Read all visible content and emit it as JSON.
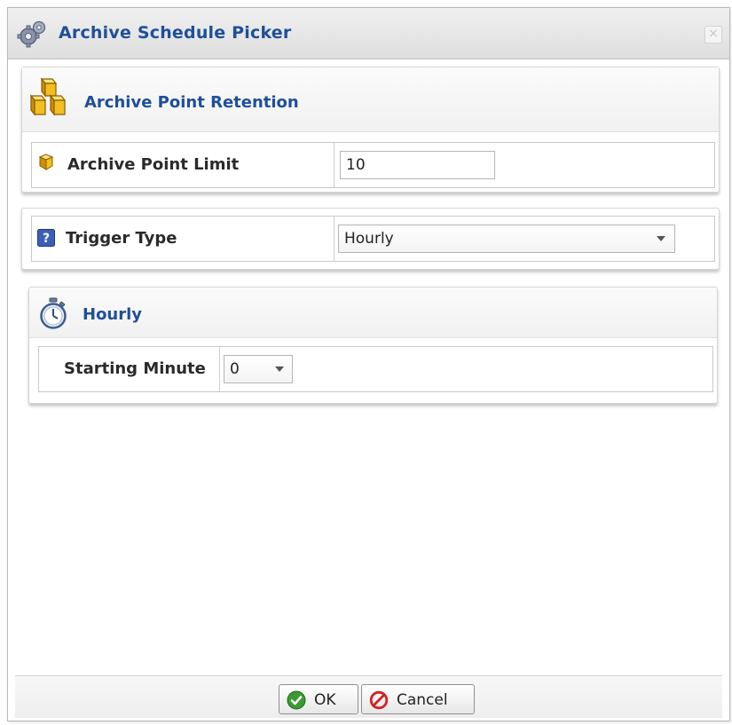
{
  "dialog": {
    "title": "Archive Schedule Picker",
    "title_icon": "gears-icon",
    "close_symbol": "×"
  },
  "retention": {
    "title": "Archive Point Retention",
    "title_icon": "stacked-cubes-icon",
    "limit_label": "Archive Point Limit",
    "limit_icon": "cube-icon",
    "limit_value": "10"
  },
  "trigger": {
    "label": "Trigger Type",
    "label_icon": "help-icon",
    "selected": "Hourly"
  },
  "hourly": {
    "title": "Hourly",
    "title_icon": "stopwatch-icon",
    "starting_minute_label": "Starting Minute",
    "starting_minute_value": "0"
  },
  "footer": {
    "ok_label": "OK",
    "ok_icon": "check-circle-icon",
    "cancel_label": "Cancel",
    "cancel_icon": "no-entry-icon"
  },
  "colors": {
    "title_blue": "#1f4f9a",
    "ok_green": "#3a9a33",
    "cancel_red": "#d42020",
    "cube_gold": "#e6b31e"
  }
}
